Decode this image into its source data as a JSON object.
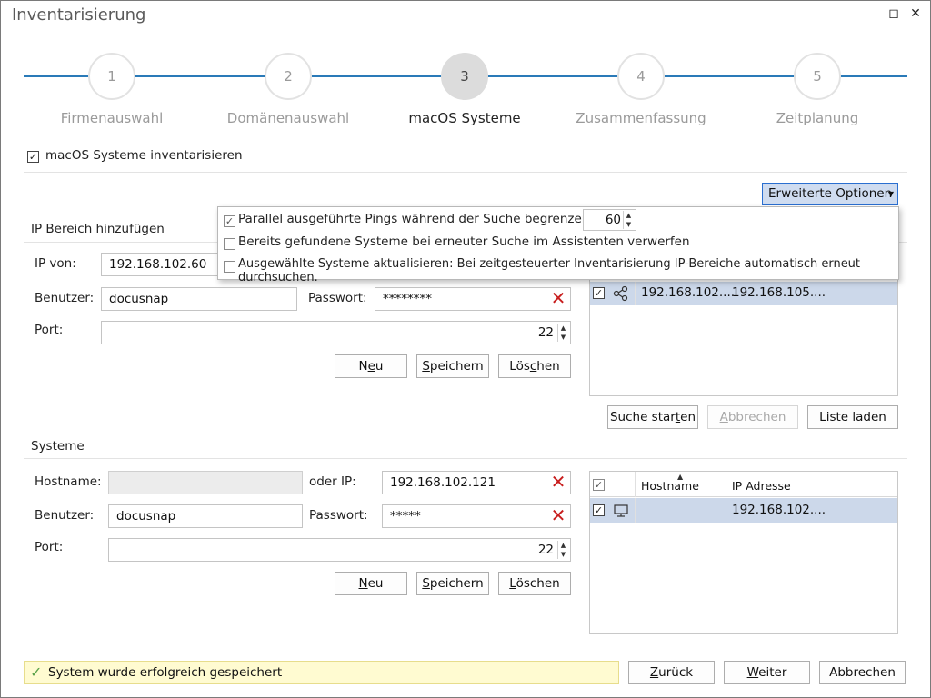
{
  "window": {
    "title": "Inventarisierung",
    "maximize_glyph": "◻",
    "close_glyph": "✕"
  },
  "steps": [
    {
      "num": "1",
      "label": "Firmenauswahl"
    },
    {
      "num": "2",
      "label": "Domänenauswahl"
    },
    {
      "num": "3",
      "label": "macOS Systeme"
    },
    {
      "num": "4",
      "label": "Zusammenfassung"
    },
    {
      "num": "5",
      "label": "Zeitplanung"
    }
  ],
  "active_step": 3,
  "inventory_checkbox": {
    "label": "macOS Systeme inventarisieren",
    "checked": true
  },
  "advanced_options": {
    "button_label": "Erweiterte Optionen",
    "items": [
      {
        "label": "Parallel ausgeführte Pings während der Suche begrenzen auf",
        "checked": true,
        "value": "60"
      },
      {
        "label": "Bereits gefundene Systeme bei erneuter Suche im Assistenten verwerfen",
        "checked": false
      },
      {
        "label": "Ausgewählte Systeme aktualisieren: Bei zeitgesteuerter Inventarisierung IP-Bereiche automatisch erneut durchsuchen.",
        "checked": false
      }
    ]
  },
  "ip_range": {
    "section_title": "IP Bereich hinzufügen",
    "ip_from_label": "IP von:",
    "ip_from_value": "192.168.102.60",
    "user_label": "Benutzer:",
    "user_value": "docusnap",
    "password_label": "Passwort:",
    "password_value": "********",
    "port_label": "Port:",
    "port_value": "22",
    "buttons": {
      "new_pre": "N",
      "new_u": "e",
      "new_post": "u",
      "save_pre": "",
      "save_u": "S",
      "save_post": "peichern",
      "delete_pre": "Lös",
      "delete_u": "c",
      "delete_post": "hen"
    },
    "grid_row": {
      "checked": true,
      "col1": "192.168.102....",
      "col2": "192.168.105...."
    },
    "search_buttons": {
      "start_pre": "Suche star",
      "start_u": "t",
      "start_post": "en",
      "cancel_pre": "",
      "cancel_u": "A",
      "cancel_post": "bbrechen",
      "load": "Liste laden"
    }
  },
  "systems": {
    "section_title": "Systeme",
    "hostname_label": "Hostname:",
    "hostname_value": "",
    "or_ip_label": "oder IP:",
    "ip_value": "192.168.102.121",
    "user_label": "Benutzer:",
    "user_value": "docusnap",
    "password_label": "Passwort:",
    "password_value": "*****",
    "port_label": "Port:",
    "port_value": "22",
    "buttons": {
      "new_pre": "",
      "new_u": "N",
      "new_post": "eu",
      "save_pre": "",
      "save_u": "S",
      "save_post": "peichern",
      "delete_pre": "",
      "delete_u": "L",
      "delete_post": "öschen"
    },
    "grid": {
      "columns": [
        "Hostname",
        "IP Adresse"
      ],
      "rows": [
        {
          "checked": true,
          "hostname": "",
          "ip": "192.168.102...."
        }
      ]
    }
  },
  "status": {
    "text": "System wurde erfolgreich gespeichert",
    "icon": "check-icon"
  },
  "footer": {
    "back_pre": "",
    "back_u": "Z",
    "back_post": "urück",
    "next_pre": "",
    "next_u": "W",
    "next_post": "eiter",
    "cancel": "Abbrechen"
  },
  "colors": {
    "accent": "#2a7ab8",
    "selected_row": "#ccd8ea",
    "status_bg": "#fffbd1",
    "clear_red": "#c81e1e"
  }
}
